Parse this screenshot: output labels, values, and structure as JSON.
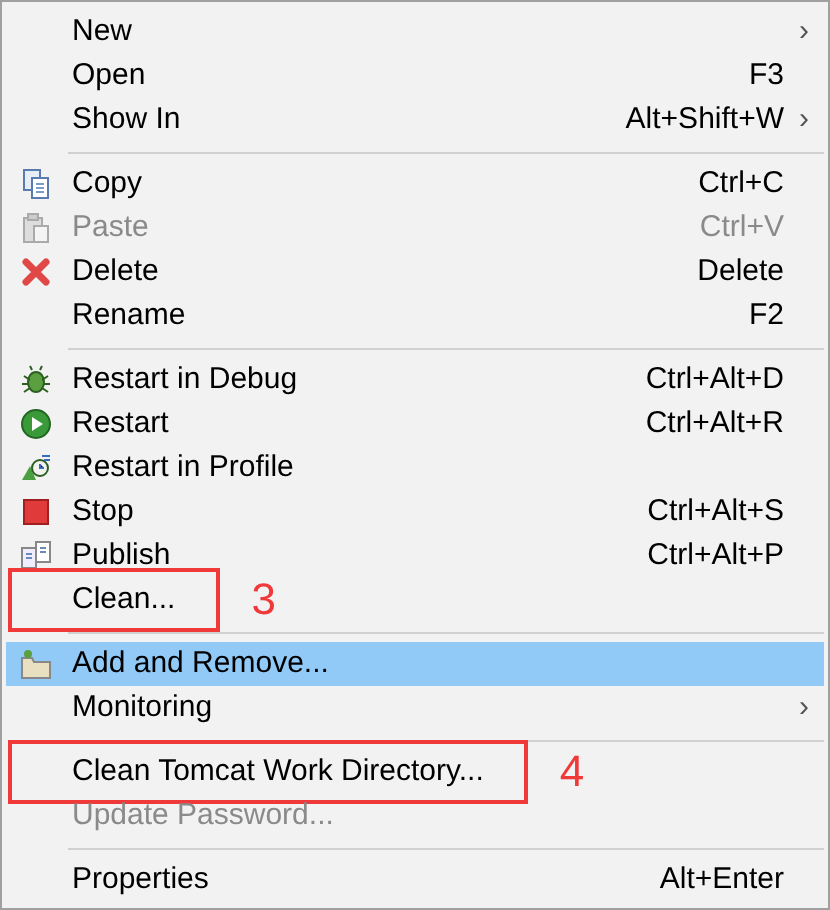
{
  "menu": {
    "items": [
      {
        "kind": "item",
        "label": "New",
        "submenu": "›",
        "disabled": false,
        "selected": false
      },
      {
        "kind": "item",
        "label": "Open",
        "shortcut": "F3",
        "disabled": false,
        "selected": false
      },
      {
        "kind": "item",
        "label": "Show In",
        "shortcut": "Alt+Shift+W",
        "submenu": "›",
        "disabled": false,
        "selected": false
      },
      {
        "kind": "separator"
      },
      {
        "kind": "item",
        "label": "Copy",
        "shortcut": "Ctrl+C",
        "disabled": false,
        "selected": false
      },
      {
        "kind": "item",
        "label": "Paste",
        "shortcut": "Ctrl+V",
        "disabled": true,
        "selected": false
      },
      {
        "kind": "item",
        "label": "Delete",
        "shortcut": "Delete",
        "disabled": false,
        "selected": false
      },
      {
        "kind": "item",
        "label": "Rename",
        "shortcut": "F2",
        "disabled": false,
        "selected": false
      },
      {
        "kind": "separator"
      },
      {
        "kind": "item",
        "label": "Restart in Debug",
        "shortcut": "Ctrl+Alt+D",
        "disabled": false,
        "selected": false
      },
      {
        "kind": "item",
        "label": "Restart",
        "shortcut": "Ctrl+Alt+R",
        "disabled": false,
        "selected": false
      },
      {
        "kind": "item",
        "label": "Restart in Profile",
        "disabled": false,
        "selected": false
      },
      {
        "kind": "item",
        "label": "Stop",
        "shortcut": "Ctrl+Alt+S",
        "disabled": false,
        "selected": false
      },
      {
        "kind": "item",
        "label": "Publish",
        "shortcut": "Ctrl+Alt+P",
        "disabled": false,
        "selected": false
      },
      {
        "kind": "item",
        "label": "Clean...",
        "annotation": "3",
        "disabled": false,
        "selected": false
      },
      {
        "kind": "separator"
      },
      {
        "kind": "item",
        "label": "Add and Remove...",
        "disabled": false,
        "selected": true
      },
      {
        "kind": "item",
        "label": "Monitoring",
        "submenu": "›",
        "disabled": false,
        "selected": false
      },
      {
        "kind": "separator"
      },
      {
        "kind": "item",
        "label": "Clean Tomcat Work Directory...",
        "annotation": "4",
        "disabled": false,
        "selected": false
      },
      {
        "kind": "item",
        "label": "Update Password...",
        "disabled": true,
        "selected": false
      },
      {
        "kind": "separator"
      },
      {
        "kind": "item",
        "label": "Properties",
        "shortcut": "Alt+Enter",
        "disabled": false,
        "selected": false
      }
    ]
  }
}
